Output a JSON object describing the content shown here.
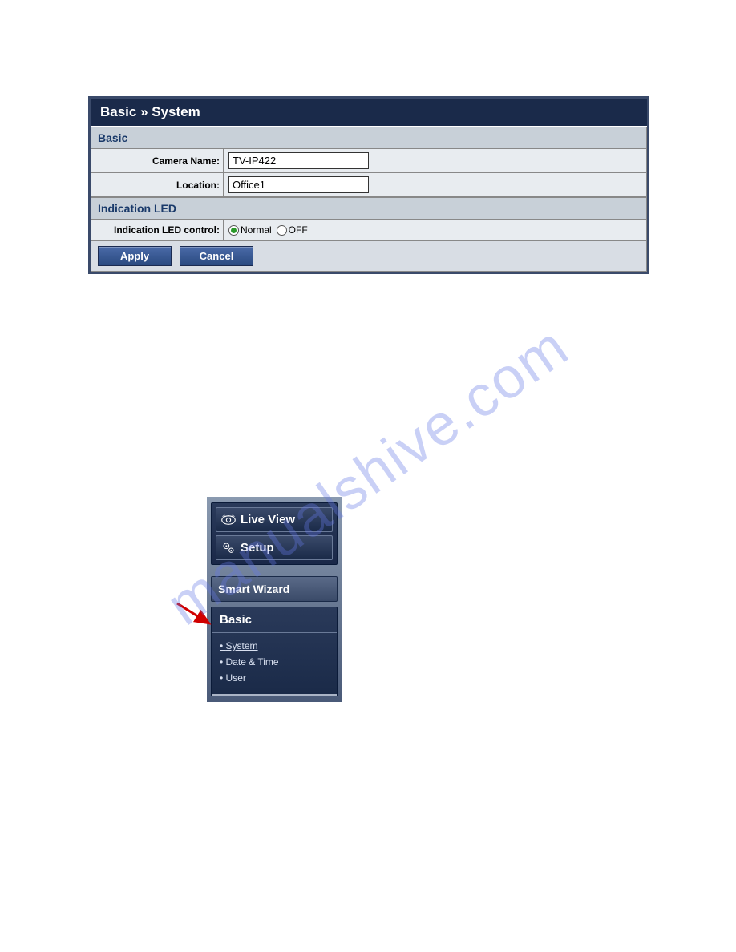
{
  "panel": {
    "breadcrumb": "Basic » System",
    "sections": {
      "basic": {
        "title": "Basic",
        "camera_name_label": "Camera Name:",
        "camera_name_value": "TV-IP422",
        "location_label": "Location:",
        "location_value": "Office1"
      },
      "led": {
        "title": "Indication LED",
        "control_label": "Indication LED control:",
        "option_normal": "Normal",
        "option_off": "OFF"
      }
    },
    "buttons": {
      "apply": "Apply",
      "cancel": "Cancel"
    }
  },
  "nav": {
    "live_view": "Live View",
    "setup": "Setup",
    "smart_wizard": "Smart Wizard",
    "basic": {
      "title": "Basic",
      "links": {
        "system": "System",
        "date_time": "Date & Time",
        "user": "User"
      }
    }
  },
  "watermark": "manualshive.com"
}
